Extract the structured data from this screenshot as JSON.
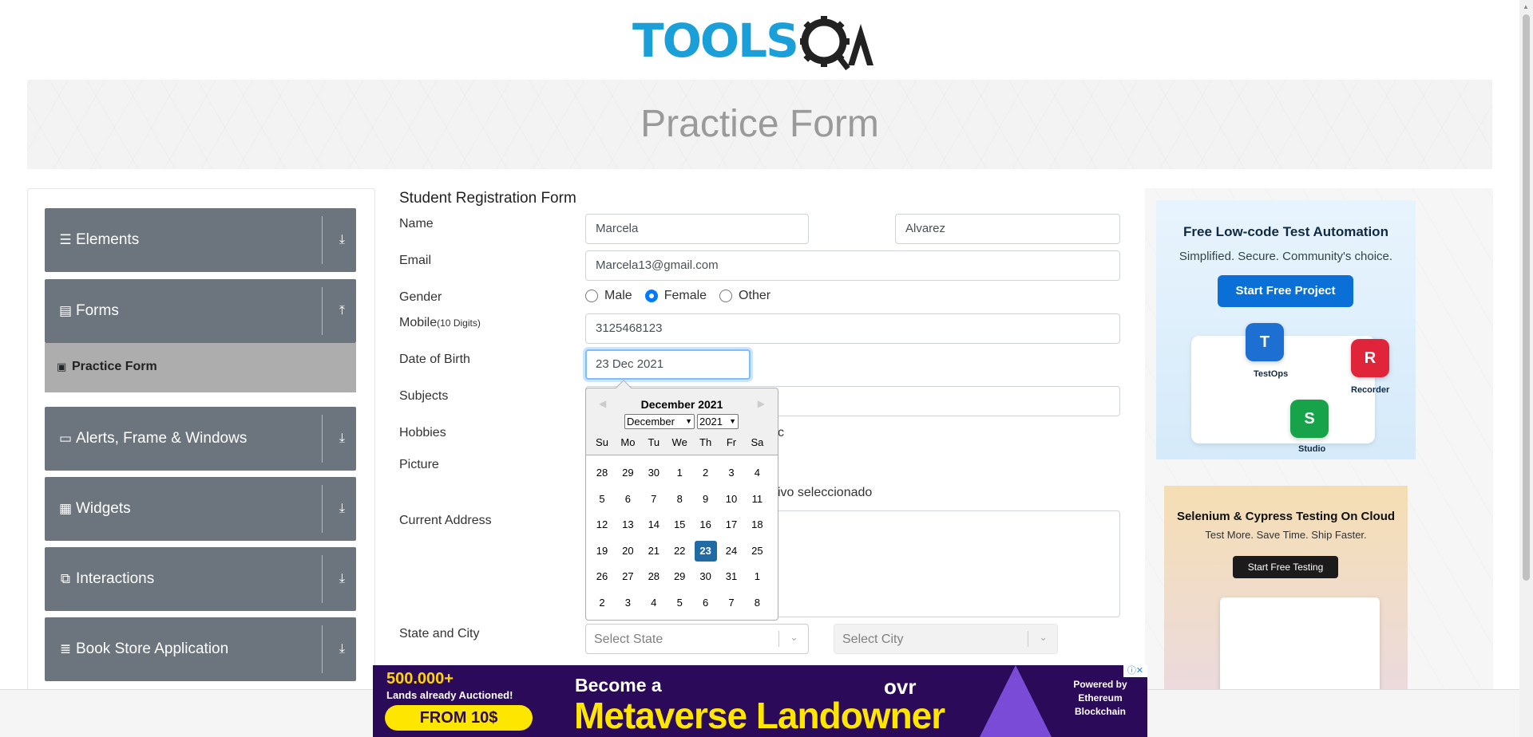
{
  "header": {
    "logo_text": "TOOLS",
    "logo_accent": "QA"
  },
  "banner": {
    "title": "Practice Form"
  },
  "sidebar": {
    "groups": [
      {
        "label": "Elements",
        "icon": "menu-icon"
      },
      {
        "label": "Forms",
        "icon": "form-icon"
      },
      {
        "label": "Alerts, Frame & Windows",
        "icon": "window-icon"
      },
      {
        "label": "Widgets",
        "icon": "widgets-icon"
      },
      {
        "label": "Interactions",
        "icon": "interactions-icon"
      },
      {
        "label": "Book Store Application",
        "icon": "books-icon"
      }
    ],
    "active_item": "Practice Form"
  },
  "form": {
    "title": "Student Registration Form",
    "labels": {
      "name": "Name",
      "email": "Email",
      "gender": "Gender",
      "mobile": "Mobile",
      "mobile_hint": "(10 Digits)",
      "dob": "Date of Birth",
      "subjects": "Subjects",
      "hobbies": "Hobbies",
      "picture": "Picture",
      "address": "Current Address",
      "state_city": "State and City"
    },
    "first_name": "Marcela",
    "last_name": "Alvarez",
    "email": "Marcela13@gmail.com",
    "gender_options": [
      "Male",
      "Female",
      "Other"
    ],
    "gender_selected": "Female",
    "mobile": "3125468123",
    "dob": "23 Dec 2021",
    "hobbies_partial": "c",
    "picture_partial": "ivo seleccionado",
    "state_placeholder": "Select State",
    "city_placeholder": "Select City"
  },
  "datepicker": {
    "header": "December 2021",
    "month_select": "December",
    "year_select": "2021",
    "day_names": [
      "Su",
      "Mo",
      "Tu",
      "We",
      "Th",
      "Fr",
      "Sa"
    ],
    "weeks": [
      [
        "28",
        "29",
        "30",
        "1",
        "2",
        "3",
        "4"
      ],
      [
        "5",
        "6",
        "7",
        "8",
        "9",
        "10",
        "11"
      ],
      [
        "12",
        "13",
        "14",
        "15",
        "16",
        "17",
        "18"
      ],
      [
        "19",
        "20",
        "21",
        "22",
        "23",
        "24",
        "25"
      ],
      [
        "26",
        "27",
        "28",
        "29",
        "30",
        "31",
        "1"
      ],
      [
        "2",
        "3",
        "4",
        "5",
        "6",
        "7",
        "8"
      ]
    ],
    "selected_day": "23"
  },
  "ads": {
    "testops": {
      "headline": "Free Low-code Test Automation",
      "sub": "Simplified. Secure. Community's choice.",
      "button": "Start Free Project",
      "tiles": [
        "TestOps",
        "Recorder",
        "Studio"
      ]
    },
    "lambdatest": {
      "headline": "Selenium & Cypress Testing On Cloud",
      "sub": "Test More. Save Time. Ship Faster.",
      "button": "Start Free Testing"
    },
    "bottom": {
      "count": "500.000+",
      "count_sub": "Lands already Auctioned!",
      "price": "FROM 10$",
      "line1": "Become a",
      "line2": "Metaverse Landowner",
      "brand": "ovr",
      "powered": "Powered by Ethereum Blockchain"
    }
  },
  "colors": {
    "brand": "#1a9fd8",
    "sidebar": "#6c757d",
    "selected_day": "#216ba5"
  }
}
